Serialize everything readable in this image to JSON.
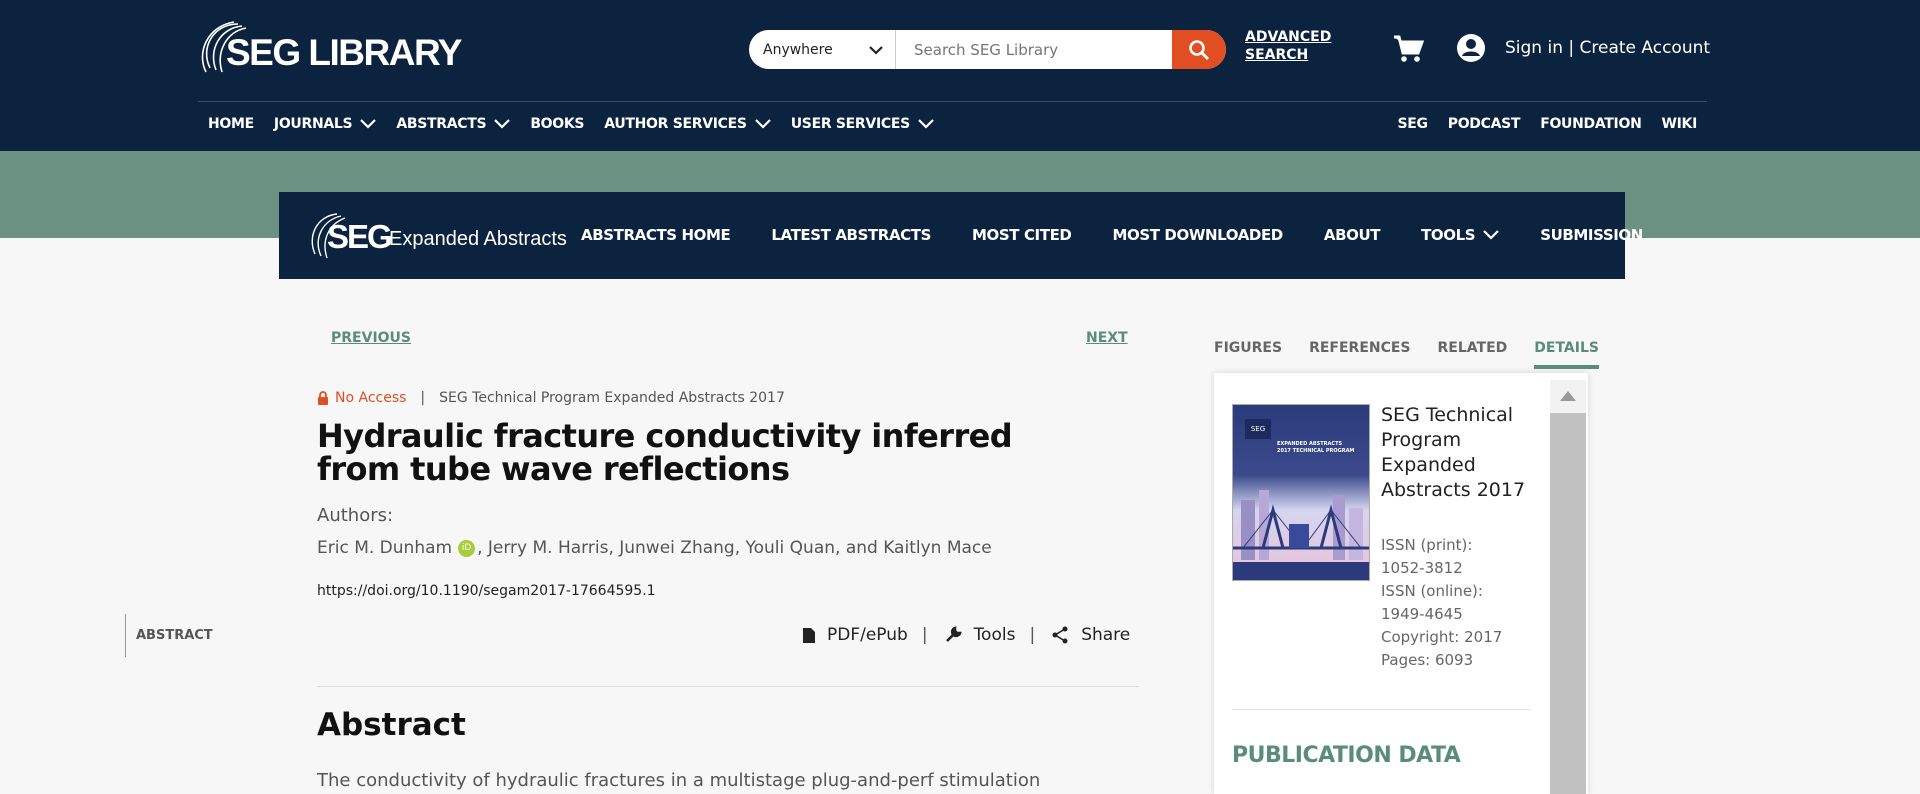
{
  "header": {
    "logo_text": "SEG LIBRARY",
    "search": {
      "scope": "Anywhere",
      "placeholder": "Search SEG Library"
    },
    "advanced_search_line1": "ADVANCED",
    "advanced_search_line2": "SEARCH",
    "signin": "Sign in | Create Account",
    "nav": [
      "HOME",
      "JOURNALS",
      "ABSTRACTS",
      "BOOKS",
      "AUTHOR SERVICES",
      "USER SERVICES"
    ],
    "right_nav": [
      "SEG",
      "PODCAST",
      "FOUNDATION",
      "WIKI"
    ]
  },
  "subheader": {
    "logo_seg": "SEG",
    "logo_text": "Expanded Abstracts",
    "nav": [
      "ABSTRACTS HOME",
      "LATEST ABSTRACTS",
      "MOST CITED",
      "MOST DOWNLOADED",
      "ABOUT",
      "TOOLS",
      "SUBMISSION"
    ]
  },
  "article": {
    "previous": "PREVIOUS",
    "next": "NEXT",
    "access": "No Access",
    "separator": "|",
    "source": "SEG Technical Program Expanded Abstracts 2017",
    "title": "Hydraulic fracture conductivity inferred from tube wave reflections",
    "authors_label": "Authors:",
    "authors_first": "Eric M. Dunham",
    "authors_rest": ", Jerry M. Harris, Junwei Zhang, Youli Quan, and Kaitlyn Mace",
    "orcid_label": "iD",
    "doi": "https://doi.org/10.1190/segam2017-17664595.1",
    "side_nav": "ABSTRACT",
    "actions": [
      "PDF/ePub",
      "Tools",
      "Share"
    ],
    "abstract_heading": "Abstract",
    "abstract_text": "The conductivity of hydraulic fractures in a multistage plug-and-perf stimulation"
  },
  "sidebar": {
    "tabs": [
      "FIGURES",
      "REFERENCES",
      "RELATED",
      "DETAILS"
    ],
    "active_tab": "DETAILS",
    "cover_tag": "SEG",
    "cover_title": "EXPANDED ABSTRACTS 2017 TECHNICAL PROGRAM",
    "pub_title": "SEG Technical Program Expanded Abstracts 2017",
    "issn_print_label": "ISSN (print):",
    "issn_print": "1052-3812",
    "issn_online_label": "ISSN (online):",
    "issn_online": "1949-4645",
    "copyright": "Copyright: 2017",
    "pages": "Pages: 6093",
    "publication_data": "PUBLICATION DATA"
  },
  "colors": {
    "navy": "#0c2340",
    "accent": "#e04e22",
    "green": "#5b8c7b",
    "band": "#6b9183"
  }
}
